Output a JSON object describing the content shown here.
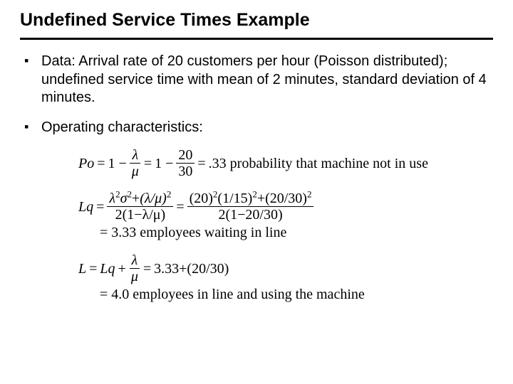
{
  "title": "Undefined Service Times Example",
  "bullets": {
    "data": "Data: Arrival rate of 20 customers per hour (Poisson distributed); undefined service time with mean of  2 minutes, standard deviation of 4 minutes.",
    "opchar": "Operating characteristics:"
  },
  "eq": {
    "po_lhs": "Po",
    "eq_sign": "=",
    "one_minus": "1 −",
    "lambda": "λ",
    "mu": "μ",
    "twenty": "20",
    "thirty": "30",
    "po_result": ".33 probability that machine not in use",
    "lq_lhs": "Lq",
    "lq_num_left": "λ",
    "lq_num_sigma": "σ",
    "lq_num_plus": "+",
    "lq_num_ratio": "(λ/μ)",
    "sq": "2",
    "lq_den_left": "2(1−λ/μ)",
    "lq_num_r_a": "(20)",
    "lq_num_r_b": "(1/15)",
    "lq_num_r_c": "(20/30)",
    "lq_den_right": "2(1−20/30)",
    "lq_result": "= 3.33 employees waiting in line",
    "l_lhs": "L",
    "l_after": "Lq",
    "plus": "+",
    "l_rhs_tail": "3.33+(20/30)",
    "l_result": "= 4.0 employees in line and using the machine"
  }
}
